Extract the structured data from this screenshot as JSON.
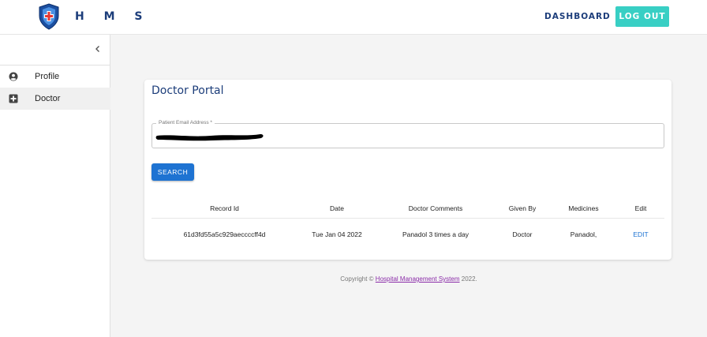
{
  "header": {
    "brand": "H M S",
    "nav": {
      "dashboard": "DASHBOARD",
      "logout": "LOG OUT"
    }
  },
  "sidebar": {
    "collapse_icon": "chevron-left-icon",
    "items": [
      {
        "label": "Profile",
        "icon": "account-circle-icon",
        "active": false
      },
      {
        "label": "Doctor",
        "icon": "plus-box-icon",
        "active": true
      }
    ]
  },
  "card": {
    "title": "Doctor Portal",
    "email_field": {
      "label": "Patient Email Address *",
      "value": ""
    },
    "search_button": "SEARCH"
  },
  "table": {
    "headers": [
      "Record Id",
      "Date",
      "Doctor Comments",
      "Given By",
      "Medicines",
      "Edit"
    ],
    "rows": [
      {
        "record_id": "61d3fd55a5c929aeccccff4d",
        "date": "Tue Jan 04 2022",
        "comments": "Panadol 3 times a day",
        "given_by": "Doctor",
        "medicines": "Panadol,",
        "edit": "EDIT"
      }
    ]
  },
  "footer": {
    "prefix": "Copyright ©",
    "link": "Hospital Management System",
    "suffix": "2022."
  },
  "colors": {
    "brand_blue": "#1c3d7a",
    "accent_teal": "#38cfc4",
    "button_blue": "#1e73d2",
    "link_purple": "#8a2ba8"
  }
}
